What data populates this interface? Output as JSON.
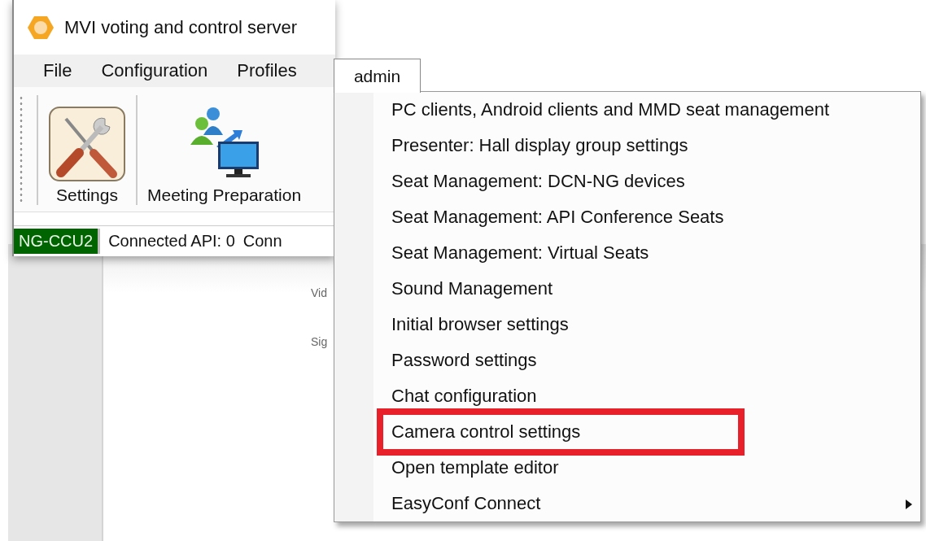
{
  "window": {
    "title": "MVI voting and control server"
  },
  "menu_bar": [
    {
      "label": "File",
      "selected": false
    },
    {
      "label": "Configuration",
      "selected": false
    },
    {
      "label": "Profiles",
      "selected": false
    },
    {
      "label": "admin",
      "selected": true
    }
  ],
  "toolbar": [
    {
      "label": "Settings",
      "kind": "settings"
    },
    {
      "label": "Meeting Preparation",
      "kind": "meeting"
    }
  ],
  "status_bar": [
    {
      "text": "NG-CCU2",
      "kind": "device"
    },
    {
      "text": "Connected API: 0",
      "kind": "plain"
    },
    {
      "text": "Conn",
      "kind": "plain"
    }
  ],
  "background_labels": [
    "Vid",
    "Sig"
  ],
  "admin_menu": {
    "items": [
      {
        "label": "PC clients, Android clients and MMD seat management",
        "highlighted": false,
        "has_submenu": false
      },
      {
        "label": "Presenter: Hall display group settings",
        "highlighted": false,
        "has_submenu": false
      },
      {
        "label": "Seat Management: DCN-NG devices",
        "highlighted": false,
        "has_submenu": false
      },
      {
        "label": "Seat Management: API Conference Seats",
        "highlighted": false,
        "has_submenu": false
      },
      {
        "label": "Seat Management: Virtual Seats",
        "highlighted": false,
        "has_submenu": false
      },
      {
        "label": "Sound Management",
        "highlighted": false,
        "has_submenu": false
      },
      {
        "label": "Initial browser settings",
        "highlighted": false,
        "has_submenu": false
      },
      {
        "label": "Password settings",
        "highlighted": false,
        "has_submenu": false
      },
      {
        "label": "Chat configuration",
        "highlighted": false,
        "has_submenu": false
      },
      {
        "label": "Camera control settings",
        "highlighted": true,
        "has_submenu": false
      },
      {
        "label": "Open template editor",
        "highlighted": false,
        "has_submenu": false
      },
      {
        "label": "EasyConf Connect",
        "highlighted": false,
        "has_submenu": true
      }
    ]
  }
}
